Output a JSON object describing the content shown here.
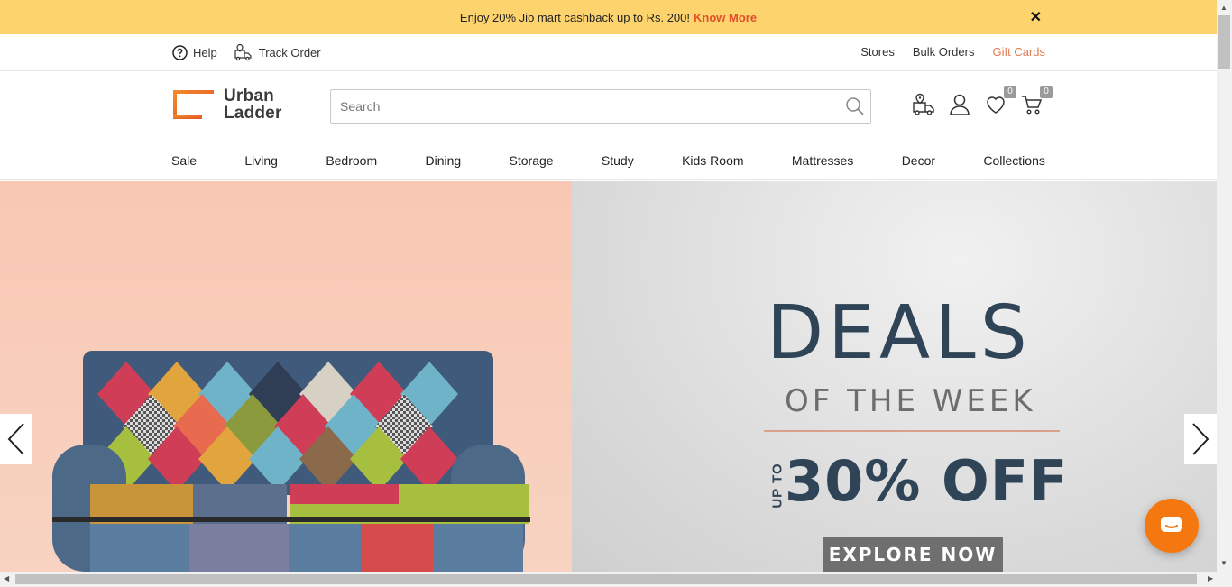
{
  "promo": {
    "text": "Enjoy 20% Jio mart cashback up to Rs. 200!",
    "link": "Know More",
    "close_icon": "close-icon"
  },
  "utility": {
    "help": "Help",
    "track_order": "Track Order",
    "stores": "Stores",
    "bulk_orders": "Bulk Orders",
    "gift_cards": "Gift Cards"
  },
  "header": {
    "logo_line1": "Urban",
    "logo_line2": "Ladder",
    "search_placeholder": "Search",
    "search_value": "",
    "wishlist_count": "0",
    "cart_count": "0",
    "icons": [
      "delivery-truck-icon",
      "account-icon",
      "wishlist-heart-icon",
      "cart-icon"
    ]
  },
  "nav": {
    "items": [
      "Sale",
      "Living",
      "Bedroom",
      "Dining",
      "Storage",
      "Study",
      "Kids Room",
      "Mattresses",
      "Decor",
      "Collections"
    ]
  },
  "hero": {
    "headline": "DEALS",
    "subheadline": "OF THE WEEK",
    "upto": "UP TO",
    "offer": "30% OFF",
    "cta": "EXPLORE NOW"
  },
  "colors": {
    "promo_bg": "#fdd36e",
    "accent": "#e0512a",
    "gift_cards": "#e27a52",
    "hero_text": "#2f4456",
    "chat_button": "#f4780f"
  }
}
